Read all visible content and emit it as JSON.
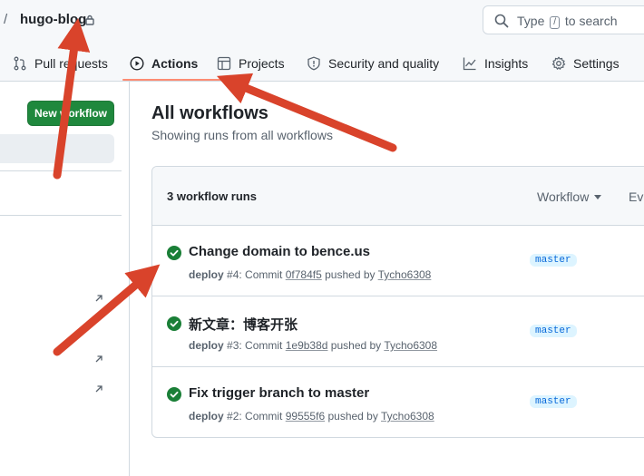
{
  "repo": {
    "separator": "/",
    "name": "hugo-blog"
  },
  "search": {
    "prefix": "Type",
    "key": "/",
    "suffix": "to search"
  },
  "nav": {
    "pull_requests": "Pull requests",
    "actions": "Actions",
    "projects": "Projects",
    "security": "Security and quality",
    "insights": "Insights",
    "settings": "Settings"
  },
  "sidebar": {
    "new_workflow": "New workflow"
  },
  "main": {
    "title": "All workflows",
    "subtitle": "Showing runs from all workflows",
    "runs_count": "3 workflow runs",
    "filter_workflow": "Workflow",
    "filter_event": "Event"
  },
  "runs": [
    {
      "title": "Change domain to bence.us",
      "workflow": "deploy",
      "number": "#4",
      "commit_label": "Commit",
      "commit": "0f784f5",
      "pushed_by_label": "pushed by",
      "user": "Tycho6308",
      "branch": "master"
    },
    {
      "title": "新文章：博客开张",
      "workflow": "deploy",
      "number": "#3",
      "commit_label": "Commit",
      "commit": "1e9b38d",
      "pushed_by_label": "pushed by",
      "user": "Tycho6308",
      "branch": "master"
    },
    {
      "title": "Fix trigger branch to master",
      "workflow": "deploy",
      "number": "#2",
      "commit_label": "Commit",
      "commit": "99555f6",
      "pushed_by_label": "pushed by",
      "user": "Tycho6308",
      "branch": "master"
    }
  ],
  "colors": {
    "accent_green": "#1f883d",
    "underline": "#fd8c73",
    "annotation_arrow": "#d9432b",
    "badge_bg": "#ddf4ff",
    "badge_text": "#0969da"
  }
}
